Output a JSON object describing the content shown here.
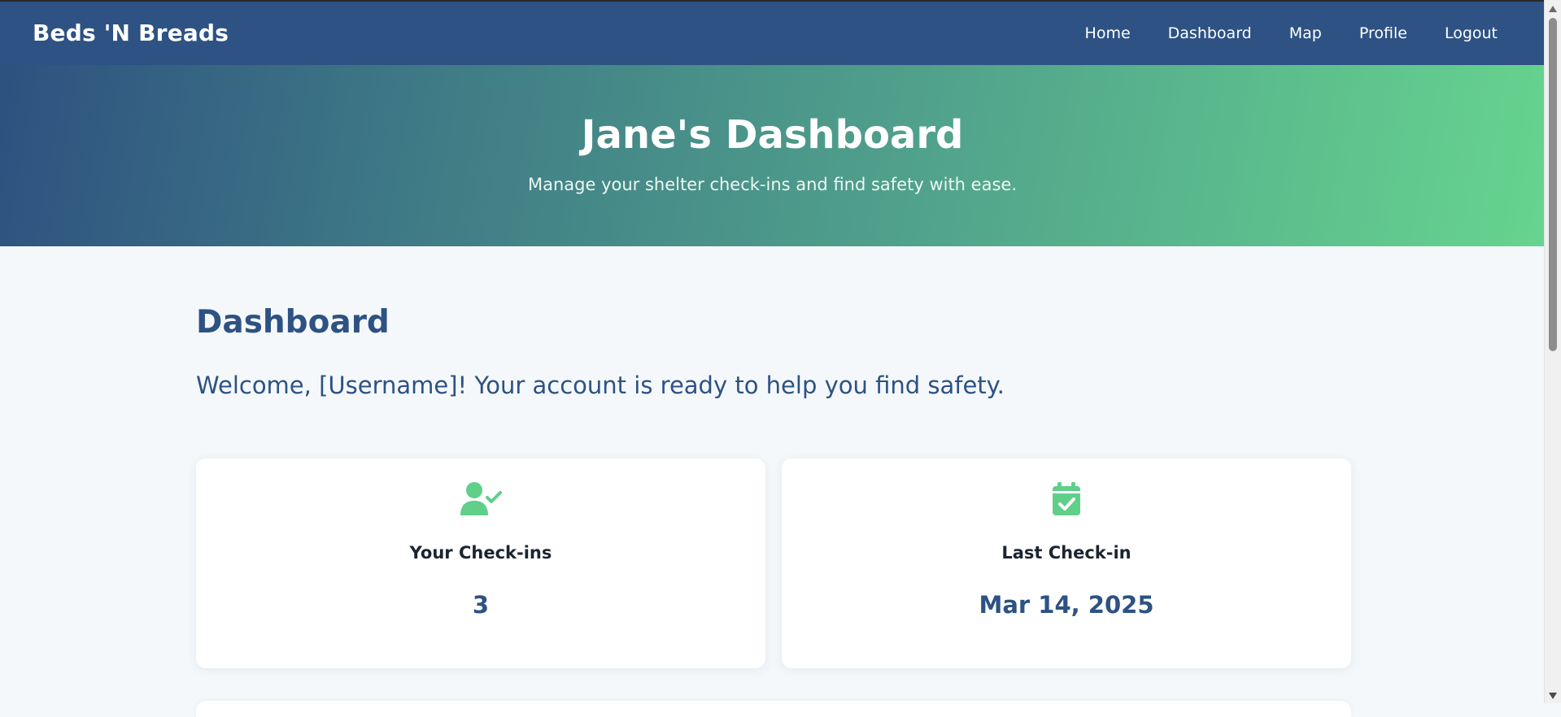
{
  "navbar": {
    "brand": "Beds 'N Breads",
    "links": [
      "Home",
      "Dashboard",
      "Map",
      "Profile",
      "Logout"
    ]
  },
  "hero": {
    "title": "Jane's Dashboard",
    "subtitle": "Manage your shelter check-ins and find safety with ease."
  },
  "main": {
    "title": "Dashboard",
    "welcome": "Welcome, [Username]! Your account is ready to help you find safety.",
    "cards": [
      {
        "icon": "user-check-icon",
        "label": "Your Check-ins",
        "value": "3"
      },
      {
        "icon": "calendar-check-icon",
        "label": "Last Check-in",
        "value": "Mar 14, 2025"
      }
    ]
  },
  "colors": {
    "navbar": "#2d5283",
    "accent_green": "#66d48e",
    "text_primary": "#2d5283",
    "icon": "#5fcf8a"
  }
}
